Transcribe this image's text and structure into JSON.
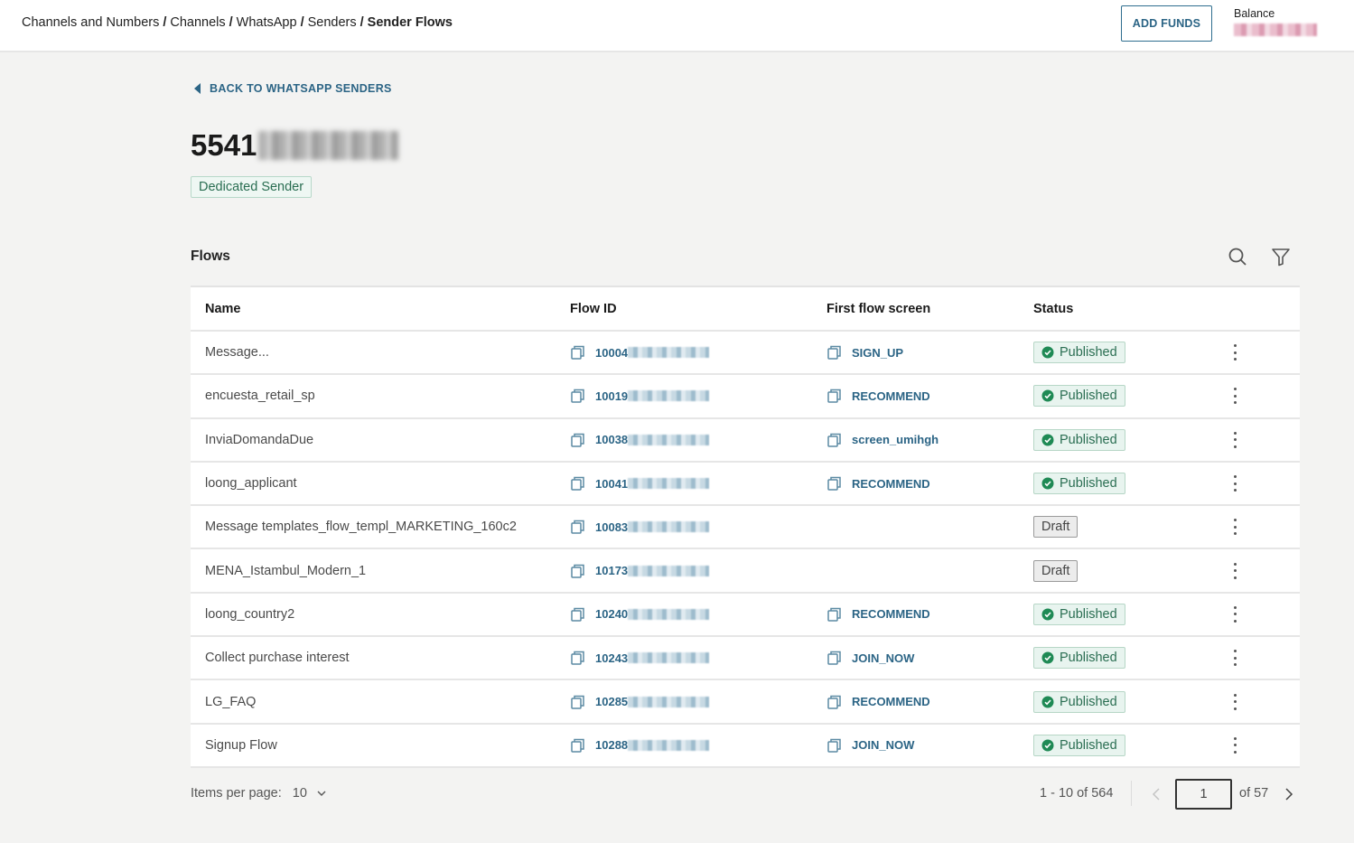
{
  "header": {
    "breadcrumb": [
      {
        "label": "Channels and Numbers"
      },
      {
        "label": "Channels"
      },
      {
        "label": "WhatsApp"
      },
      {
        "label": "Senders"
      },
      {
        "label": "Sender Flows"
      }
    ],
    "add_funds_label": "ADD FUNDS",
    "balance_label": "Balance",
    "balance_value": "[redacted]"
  },
  "back_link_label": "BACK TO WHATSAPP SENDERS",
  "sender": {
    "number_prefix": "5541",
    "number_redacted": "[redacted]",
    "type_badge": "Dedicated Sender"
  },
  "flows": {
    "title": "Flows",
    "columns": [
      "Name",
      "Flow ID",
      "First flow screen",
      "Status"
    ],
    "rows": [
      {
        "name": "Message...",
        "flow_id": "10004",
        "first_screen": "SIGN_UP",
        "status": "Published"
      },
      {
        "name": "encuesta_retail_sp",
        "flow_id": "10019",
        "first_screen": "RECOMMEND",
        "status": "Published"
      },
      {
        "name": "InviaDomandaDue",
        "flow_id": "10038",
        "first_screen": "screen_umihgh",
        "status": "Published"
      },
      {
        "name": "loong_applicant",
        "flow_id": "10041",
        "first_screen": "RECOMMEND",
        "status": "Published"
      },
      {
        "name": "Message templates_flow_templ_MARKETING_160c2",
        "flow_id": "10083",
        "first_screen": "",
        "status": "Draft"
      },
      {
        "name": "MENA_Istambul_Modern_1",
        "flow_id": "10173",
        "first_screen": "",
        "status": "Draft"
      },
      {
        "name": "loong_country2",
        "flow_id": "10240",
        "first_screen": "RECOMMEND",
        "status": "Published"
      },
      {
        "name": "Collect purchase interest",
        "flow_id": "10243",
        "first_screen": "JOIN_NOW",
        "status": "Published"
      },
      {
        "name": "LG_FAQ",
        "flow_id": "10285",
        "first_screen": "RECOMMEND",
        "status": "Published"
      },
      {
        "name": "Signup Flow",
        "flow_id": "10288",
        "first_screen": "JOIN_NOW",
        "status": "Published"
      }
    ]
  },
  "pagination": {
    "items_per_page_label": "Items per page:",
    "items_per_page_value": "10",
    "range_text": "1 - 10 of 564",
    "current_page": "1",
    "of_pages": "of 57"
  },
  "colors": {
    "accent": "#2b6485",
    "published_text": "#2a6e52",
    "published_bg": "#e8f4ef",
    "draft_bg": "#ececec",
    "page_bg": "#f3f3f2"
  }
}
